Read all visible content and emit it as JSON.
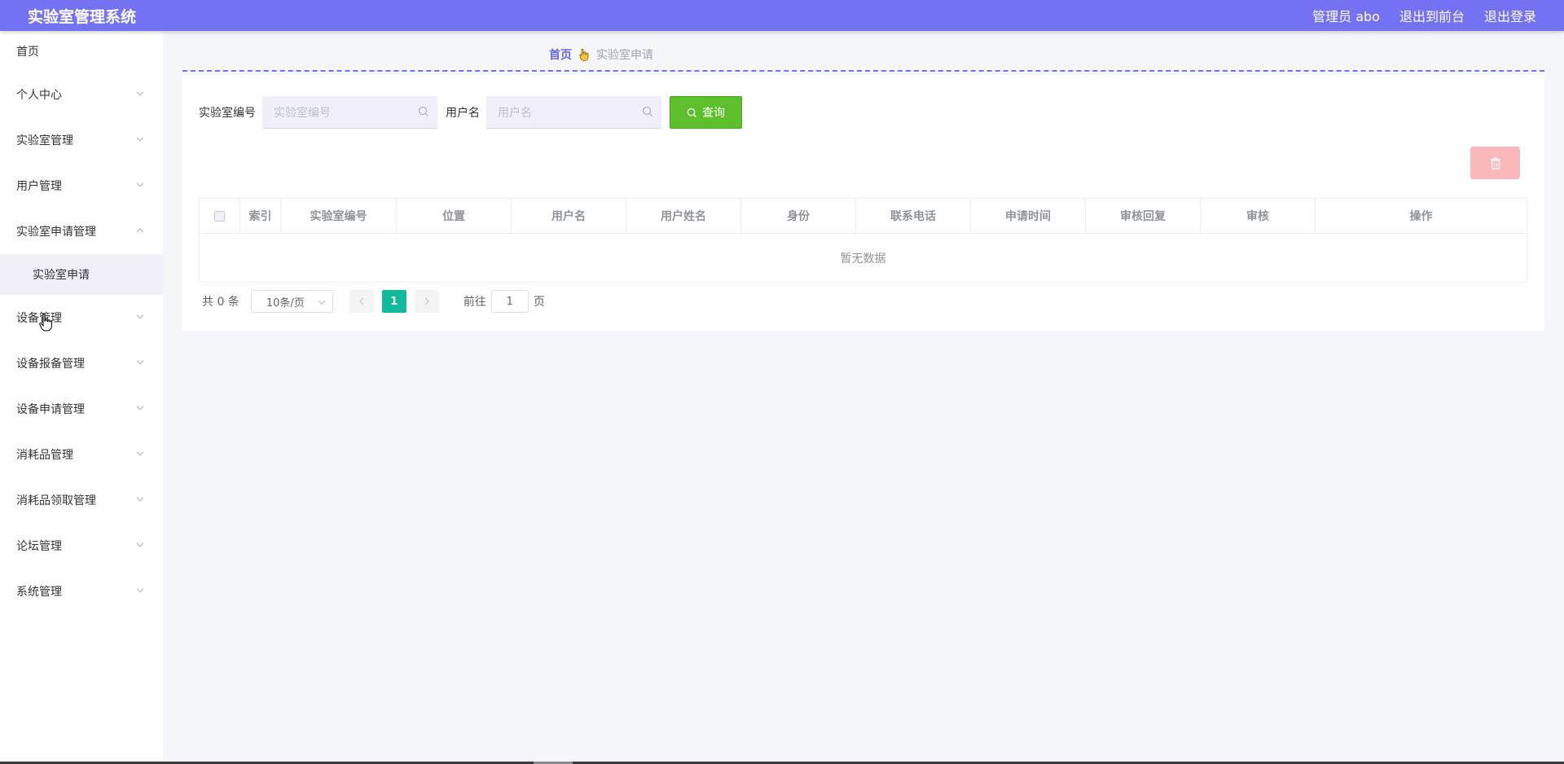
{
  "header": {
    "app_title": "实验室管理系统",
    "admin_label": "管理员 abo",
    "exit_front_label": "退出到前台",
    "logout_label": "退出登录",
    "bg_color": "#7472f3"
  },
  "sidebar": {
    "items": [
      {
        "label": "首页"
      },
      {
        "label": "个人中心"
      },
      {
        "label": "实验室管理"
      },
      {
        "label": "用户管理"
      },
      {
        "label": "实验室申请管理"
      },
      {
        "label": "设备管理"
      },
      {
        "label": "设备报备管理"
      },
      {
        "label": "设备申请管理"
      },
      {
        "label": "消耗品管理"
      },
      {
        "label": "消耗品领取管理"
      },
      {
        "label": "论坛管理"
      },
      {
        "label": "系统管理"
      }
    ],
    "sub_item": {
      "label": "实验室申请"
    }
  },
  "breadcrumb": {
    "home": "首页",
    "icon": "hand-icon",
    "current": "实验室申请"
  },
  "search": {
    "lab_no_label": "实验室编号",
    "lab_no_placeholder": "实验室编号",
    "username_label": "用户名",
    "username_placeholder": "用户名",
    "query_button": "查询"
  },
  "table": {
    "columns": [
      "索引",
      "实验室编号",
      "位置",
      "用户名",
      "用户姓名",
      "身份",
      "联系电话",
      "申请时间",
      "审核回复",
      "审核",
      "操作"
    ],
    "empty_text": "暂无数据"
  },
  "pagination": {
    "total_text": "共 0 条",
    "page_size": "10条/页",
    "current_page": "1",
    "goto_label": "前往",
    "goto_value": "1",
    "page_suffix": "页"
  },
  "colors": {
    "accent": "#7472f3",
    "query_button": "#5cbf2b",
    "delete_button": "#f9b8ba",
    "page_active": "#13b99b"
  }
}
